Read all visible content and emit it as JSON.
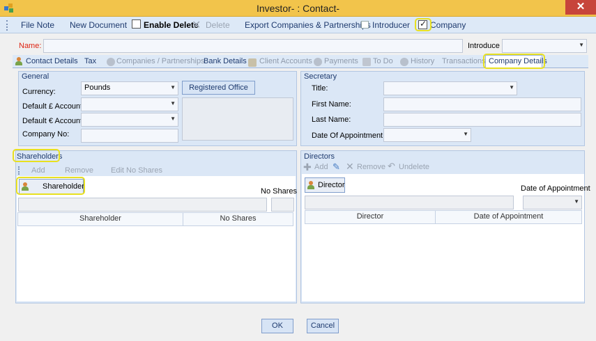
{
  "window": {
    "title": "Investor- : Contact-",
    "close": "✕"
  },
  "toolbar": {
    "file_note": "File Note",
    "new_document": "New Document",
    "enable_delete": "Enable Delete",
    "delete": "Delete",
    "export": "Export Companies & Partnerships",
    "introducer": "Introducer",
    "company": "Company",
    "company_checked": true
  },
  "form": {
    "name_label": "Name:",
    "name_value": "",
    "introduce_label": "Introduce"
  },
  "tabs": [
    {
      "label": "Contact Details"
    },
    {
      "label": "Tax"
    },
    {
      "label": "Companies / Partnerships"
    },
    {
      "label": "Bank Details"
    },
    {
      "label": "Client Accounts"
    },
    {
      "label": "Payments"
    },
    {
      "label": "To Do"
    },
    {
      "label": "History"
    },
    {
      "label": "Transactions"
    },
    {
      "label": "Company Details",
      "active": true
    }
  ],
  "general": {
    "title": "General",
    "currency_label": "Currency:",
    "currency_value": "Pounds",
    "default_gbp_label": "Default £ Account",
    "default_eur_label": "Default € Account",
    "company_no_label": "Company No:",
    "registered_office": "Registered Office"
  },
  "secretary": {
    "title": "Secretary",
    "title_label": "Title:",
    "first_name_label": "First Name:",
    "last_name_label": "Last Name:",
    "date_label": "Date Of Appointment:"
  },
  "shareholders": {
    "title": "Shareholders",
    "add": "Add",
    "remove": "Remove",
    "edit_no_shares": "Edit No Shares",
    "shareholder_button": "Shareholder",
    "no_shares_label": "No Shares",
    "columns": [
      "Shareholder",
      "No Shares"
    ]
  },
  "directors": {
    "title": "Directors",
    "add": "Add",
    "remove": "Remove",
    "undelete": "Undelete",
    "director_button": "Director",
    "date_label": "Date of Appointment",
    "columns": [
      "Director",
      "Date of Appointment"
    ]
  },
  "footer": {
    "ok": "OK",
    "cancel": "Cancel"
  },
  "colors": {
    "titlebar": "#f2c44b",
    "close": "#c7453b",
    "highlight": "#e8e020",
    "panel": "#dbe7f6"
  }
}
